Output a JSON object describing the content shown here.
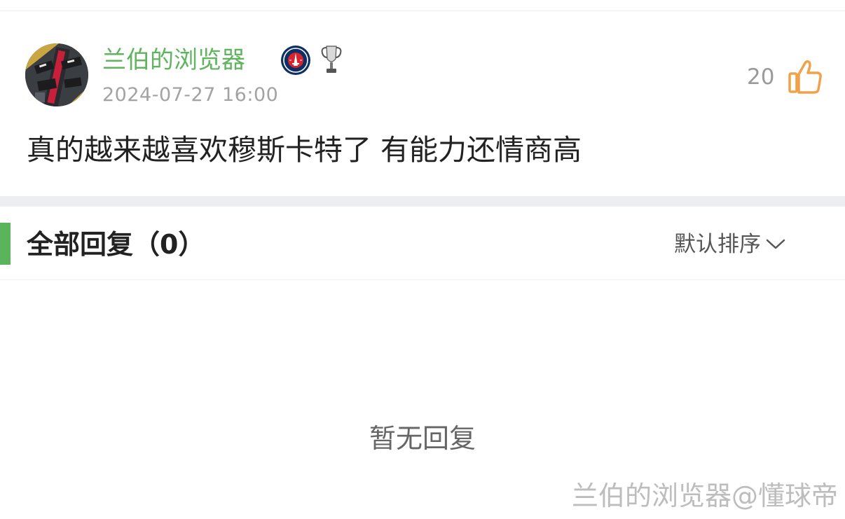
{
  "post": {
    "author": {
      "name": "兰伯的浏览器",
      "avatar_icon": "avatar-image",
      "badges": [
        "psg-badge-icon",
        "champions-league-trophy-icon"
      ]
    },
    "timestamp": "2024-07-27 16:00",
    "content": "真的越来越喜欢穆斯卡特了 有能力还情商高",
    "likes": {
      "count": "20",
      "icon": "thumbs-up-icon"
    }
  },
  "replies": {
    "title": "全部回复（0）",
    "sort_label": "默认排序",
    "sort_icon": "chevron-down-icon",
    "empty_text": "暂无回复"
  },
  "watermark": "兰伯的浏览器@懂球帝",
  "colors": {
    "username": "#5eb55e",
    "accent_bar": "#5ab55a",
    "like_icon": "#f0a14a",
    "muted_text": "#a3a3a3",
    "divider_band": "#eceef1"
  }
}
